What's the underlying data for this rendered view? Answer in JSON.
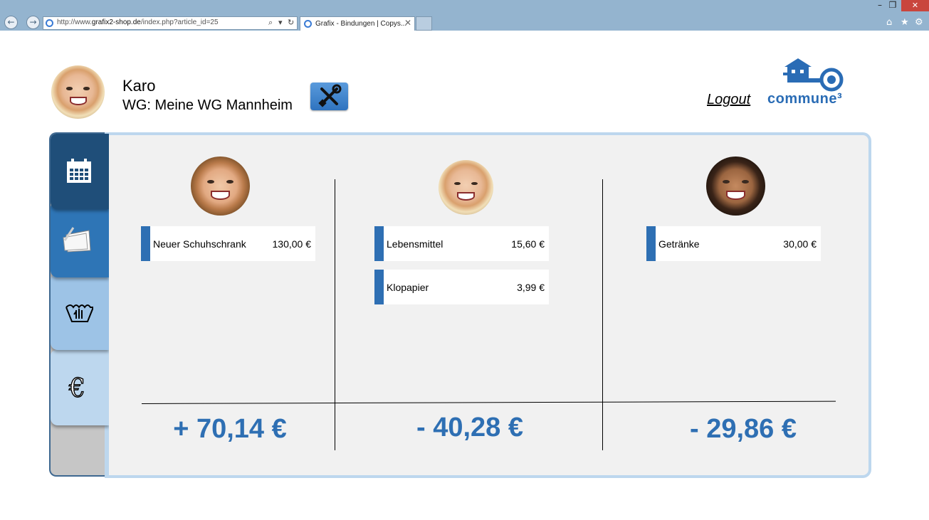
{
  "browser": {
    "back_icon": "←",
    "forward_icon": "→",
    "url_prefix": "http://www.",
    "url_domain": "grafix2-shop.de",
    "url_path": "/index.php?article_id=25",
    "search_icon": "⌕",
    "dropdown_icon": "▾",
    "refresh_icon": "↻",
    "tab_title": "Grafix - Bindungen | Copys...",
    "tab_close": "✕",
    "minimize": "–",
    "restore": "❐",
    "close": "✕",
    "home_icon": "⌂",
    "favorites_icon": "★",
    "settings_icon": "⚙"
  },
  "header": {
    "user_name": "Karo",
    "wg_label": "WG: Meine WG Mannheim",
    "logout": "Logout",
    "brand": "commune³"
  },
  "sidebar": {
    "tabs": [
      {
        "name": "calendar",
        "color": "#1f4e79"
      },
      {
        "name": "notes",
        "color": "#2e75b6"
      },
      {
        "name": "laundry",
        "color": "#9dc3e6"
      },
      {
        "name": "finances",
        "color": "#bdd7ee"
      }
    ]
  },
  "columns": [
    {
      "items": [
        {
          "label": "Neuer Schuhschrank",
          "amount": "130,00 €"
        }
      ],
      "total": "+ 70,14 €"
    },
    {
      "items": [
        {
          "label": "Lebensmittel",
          "amount": "15,60 €"
        },
        {
          "label": "Klopapier",
          "amount": "3,99 €"
        }
      ],
      "total": "- 40,28 €"
    },
    {
      "items": [
        {
          "label": "Getränke",
          "amount": "30,00 €"
        }
      ],
      "total": "- 29,86 €"
    }
  ],
  "colors": {
    "accent": "#2e6fb3",
    "panel_border": "#bdd7ee",
    "panel_bg": "#f1f1f1"
  }
}
